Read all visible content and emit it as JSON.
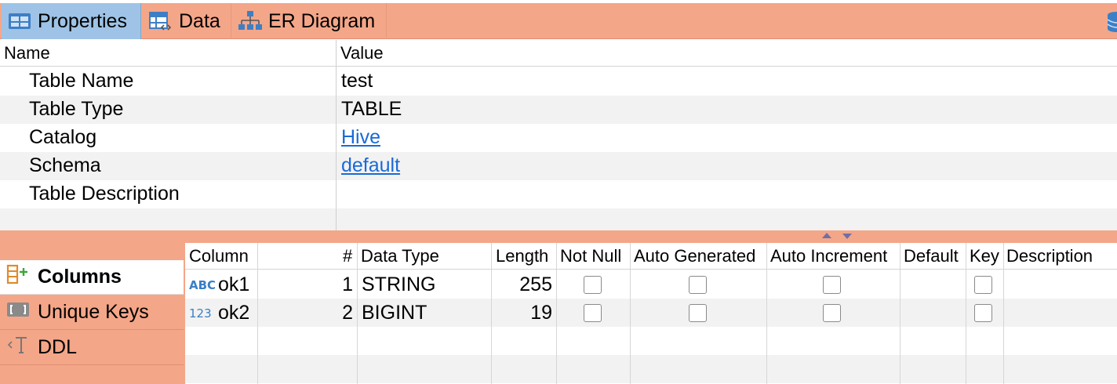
{
  "tabs": [
    {
      "label": "Properties",
      "icon": "table-grid-icon",
      "active": true
    },
    {
      "label": "Data",
      "icon": "data-grid-icon",
      "active": false
    },
    {
      "label": "ER Diagram",
      "icon": "er-diagram-icon",
      "active": false
    }
  ],
  "properties": {
    "header": {
      "name": "Name",
      "value": "Value"
    },
    "rows": [
      {
        "name": "Table Name",
        "value": "test",
        "link": false
      },
      {
        "name": "Table Type",
        "value": "TABLE",
        "link": false
      },
      {
        "name": "Catalog",
        "value": "Hive",
        "link": true
      },
      {
        "name": "Schema",
        "value": "default",
        "link": true
      },
      {
        "name": "Table Description",
        "value": "",
        "link": false
      }
    ]
  },
  "sidetabs": [
    {
      "label": "Columns",
      "icon": "columns-add-icon",
      "active": true
    },
    {
      "label": "Unique Keys",
      "icon": "unique-key-icon",
      "active": false
    },
    {
      "label": "DDL",
      "icon": "ddl-icon",
      "active": false
    }
  ],
  "columns": {
    "headers": {
      "column": "Column",
      "num": "#",
      "data_type": "Data Type",
      "length": "Length",
      "not_null": "Not Null",
      "auto_generated": "Auto Generated",
      "auto_increment": "Auto Increment",
      "default": "Default",
      "key": "Key",
      "description": "Description"
    },
    "rows": [
      {
        "type_icon": "ABC",
        "name": "ok1",
        "num": "1",
        "data_type": "STRING",
        "length": "255",
        "not_null": false,
        "auto_generated": false,
        "auto_increment": false,
        "key": false
      },
      {
        "type_icon": "123",
        "name": "ok2",
        "num": "2",
        "data_type": "BIGINT",
        "length": "19",
        "not_null": false,
        "auto_generated": false,
        "auto_increment": false,
        "key": false
      }
    ]
  },
  "colors": {
    "tabbar": "#f4a688",
    "active_tab": "#9ec3e6",
    "link": "#1a6ad8"
  }
}
